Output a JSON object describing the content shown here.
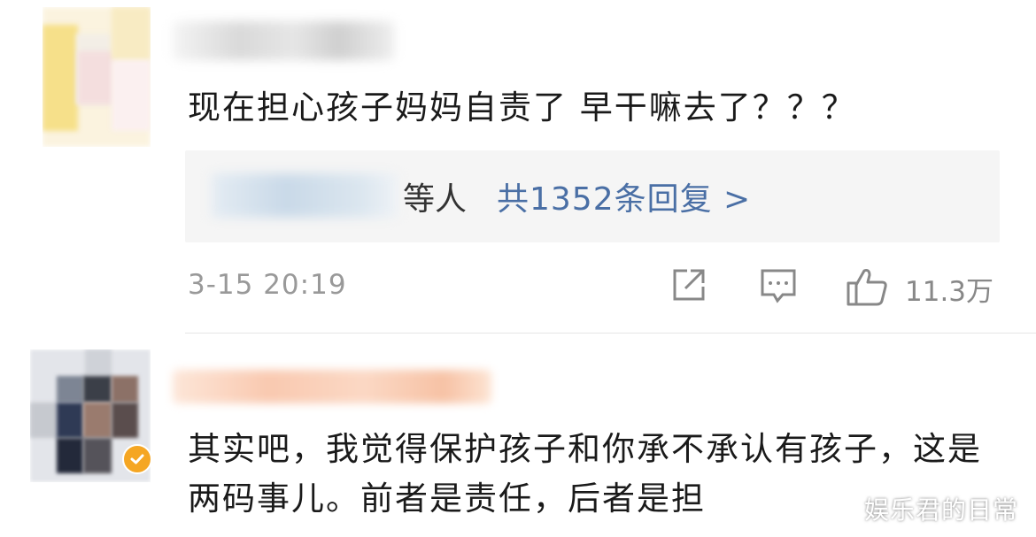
{
  "comment1": {
    "text": "现在担心孩子妈妈自责了  早干嘛去了？？？",
    "replies": {
      "who_suffix": "等人",
      "count_text": "共1352条回复 >"
    },
    "timestamp": "3-15 20:19",
    "actions": {
      "share_icon": "share-icon",
      "comment_icon": "comment-icon",
      "like_icon": "thumbs-up-icon",
      "like_count": "11.3万"
    }
  },
  "comment2": {
    "text": "其实吧，我觉得保护孩子和你承不承认有孩子，这是两码事儿。前者是责任，后者是担",
    "verified_icon": "verified-badge-icon"
  },
  "watermark": "娱乐君的日常",
  "colors": {
    "link": "#4a6fa5",
    "text": "#1a1a1a",
    "meta": "#999999",
    "reply_bg": "#f5f5f5",
    "verified": "#f5a623"
  }
}
